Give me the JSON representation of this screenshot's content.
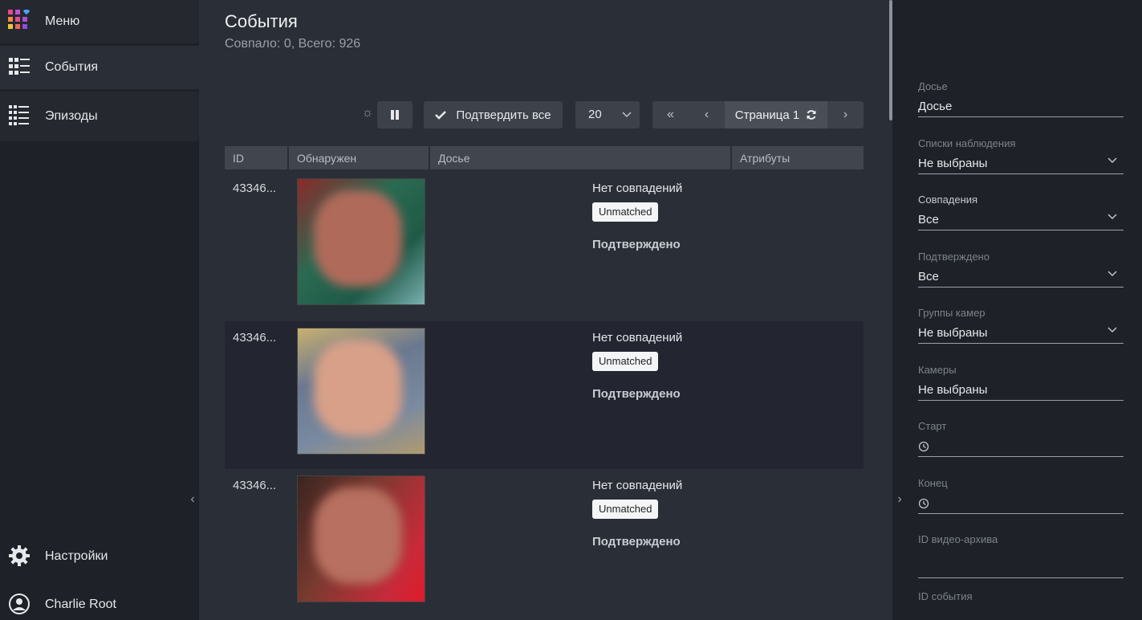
{
  "sidebar": {
    "menu_label": "Меню",
    "events_label": "События",
    "episodes_label": "Эпизоды",
    "settings_label": "Настройки",
    "user_label": "Charlie Root",
    "collapse_glyph": "‹"
  },
  "header": {
    "title": "События",
    "subtitle": "Совпало: 0, Всего: 926"
  },
  "toolbar": {
    "confirm_all_label": "Подтвердить все",
    "page_size": "20",
    "page_label": "Страница 1",
    "first_glyph": "«",
    "prev_glyph": "‹",
    "next_glyph": "›",
    "spinner_glyph": "☼"
  },
  "table": {
    "columns": [
      "ID",
      "Обнаружен",
      "Досье",
      "Атрибуты"
    ],
    "rows": [
      {
        "id": "43346...",
        "match": "Нет совпадений",
        "badge": "Unmatched",
        "status": "Подтверждено"
      },
      {
        "id": "43346...",
        "match": "Нет совпадений",
        "badge": "Unmatched",
        "status": "Подтверждено"
      },
      {
        "id": "43346...",
        "match": "Нет совпадений",
        "badge": "Unmatched",
        "status": "Подтверждено"
      }
    ]
  },
  "filters": {
    "expand_glyph": "›",
    "dossier": {
      "label": "Досье",
      "value": "Досье"
    },
    "watchlists": {
      "label": "Списки наблюдения",
      "value": "Не выбраны"
    },
    "matches": {
      "label": "Совпадения",
      "value": "Все"
    },
    "confirmed": {
      "label": "Подтверждено",
      "value": "Все"
    },
    "camera_groups": {
      "label": "Группы камер",
      "value": "Не выбраны"
    },
    "cameras": {
      "label": "Камеры",
      "value": "Не выбраны"
    },
    "start": {
      "label": "Старт",
      "value": ""
    },
    "end": {
      "label": "Конец",
      "value": ""
    },
    "video_archive_id": {
      "label": "ID видео-архива",
      "value": ""
    },
    "event_id": {
      "label": "ID события",
      "value": ""
    }
  }
}
